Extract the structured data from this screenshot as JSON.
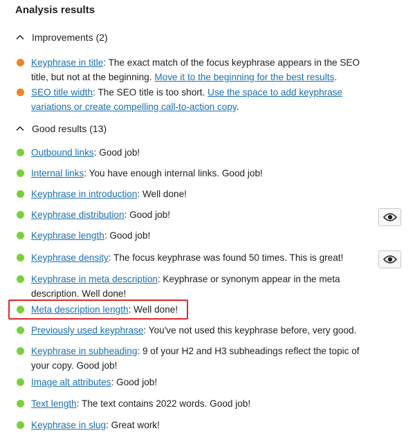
{
  "title": "Analysis results",
  "colors": {
    "improvement": "#ed8526",
    "good": "#7ad03a",
    "link": "#1a6fb0",
    "highlight": "#e0262a"
  },
  "improvements": {
    "header": "Improvements (2)",
    "items": [
      {
        "link": "Keyphrase in title",
        "text": ": The exact match of the focus keyphrase appears in the SEO title, but not at the beginning. ",
        "link2": "Move it to the beginning for the best results",
        "tail": "."
      },
      {
        "link": "SEO title width",
        "text": ": The SEO title is too short. ",
        "link2": "Use the space to add keyphrase variations or create compelling call-to-action copy",
        "tail": "."
      }
    ]
  },
  "good": {
    "header": "Good results (13)",
    "items": [
      {
        "link": "Outbound links",
        "text": ": Good job!"
      },
      {
        "link": "Internal links",
        "text": ": You have enough internal links. Good job!"
      },
      {
        "link": "Keyphrase in introduction",
        "text": ": Well done!"
      },
      {
        "link": "Keyphrase distribution",
        "text": ": Good job!",
        "eye": "eye-icon"
      },
      {
        "link": "Keyphrase length",
        "text": ": Good job!"
      },
      {
        "link": "Keyphrase density",
        "text": ": The focus keyphrase was found 50 times. This is great!",
        "eye": "eye-icon"
      },
      {
        "link": "Keyphrase in meta description",
        "text": ": Keyphrase or synonym appear in the meta description. Well done!"
      },
      {
        "link": "Meta description length",
        "text": ": Well done!"
      },
      {
        "link": "Previously used keyphrase",
        "text": ": You've not used this keyphrase before, very good."
      },
      {
        "link": "Keyphrase in subheading",
        "text": ": 9 of your H2 and H3 subheadings reflect the topic of your copy. Good job!"
      },
      {
        "link": "Image alt attributes",
        "text": ": Good job!"
      },
      {
        "link": "Text length",
        "text": ": The text contains 2022 words. Good job!"
      },
      {
        "link": "Keyphrase in slug",
        "text": ": Great work!"
      }
    ]
  }
}
